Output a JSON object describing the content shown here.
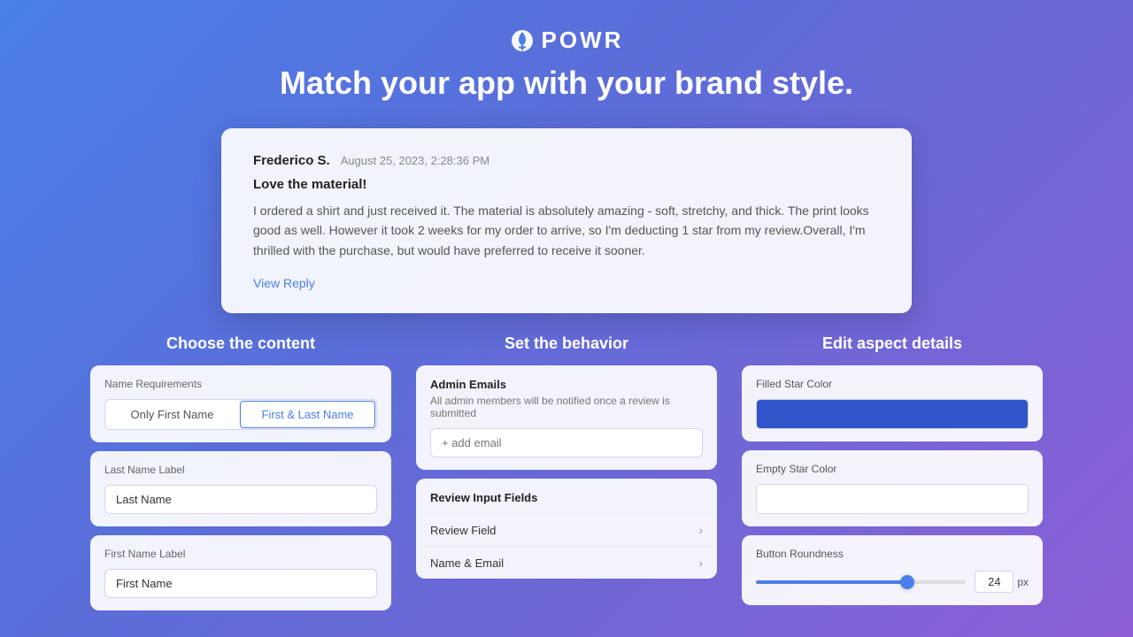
{
  "header": {
    "logo_text": "POWR",
    "headline": "Match your app with your brand style."
  },
  "preview": {
    "reviewer_name": "Frederico S.",
    "review_date": "August 25, 2023, 2:28:36 PM",
    "review_title": "Love the material!",
    "review_body": "I ordered a shirt and just received it. The material is absolutely amazing - soft, stretchy, and thick. The print looks good as well. However it took 2 weeks for my order to arrive, so I'm deducting 1 star from my review.Overall, I'm thrilled with the purchase, but would have preferred to receive it sooner.",
    "view_reply_label": "View Reply"
  },
  "content_column": {
    "title": "Choose the content",
    "name_requirements": {
      "label": "Name Requirements",
      "only_first_name": "Only First Name",
      "first_last_name": "First & Last Name"
    },
    "last_name_label": {
      "label": "Last Name Label",
      "placeholder": "Last Name"
    },
    "first_name_label": {
      "label": "First Name Label",
      "placeholder": "First Name"
    }
  },
  "behavior_column": {
    "title": "Set the behavior",
    "admin_emails": {
      "title": "Admin Emails",
      "description": "All admin members will be notified once a review is submitted",
      "email_placeholder": "+ add email"
    },
    "review_input_fields": {
      "title": "Review Input Fields",
      "fields": [
        {
          "label": "Review Field"
        },
        {
          "label": "Name & Email"
        }
      ]
    }
  },
  "aspect_column": {
    "title": "Edit aspect details",
    "filled_star_color": {
      "label": "Filled Star Color",
      "color": "#3355cc"
    },
    "empty_star_color": {
      "label": "Empty Star Color",
      "color": "#ffffff"
    },
    "button_roundness": {
      "label": "Button Roundness",
      "value": "24",
      "unit": "px",
      "fill_percent": "72"
    }
  }
}
